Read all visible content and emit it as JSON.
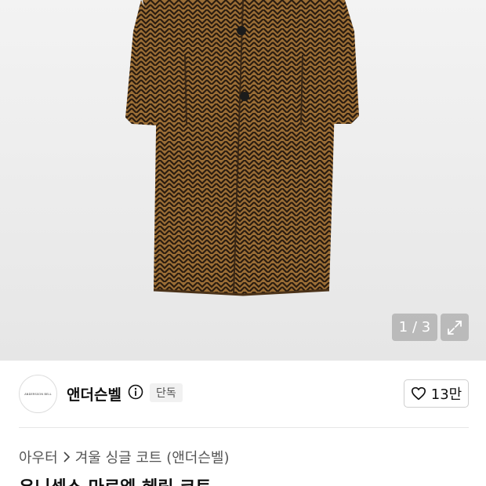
{
  "image_pager": {
    "counter": "1 / 3"
  },
  "brand": {
    "logo_text": "ANDERSSON BELL",
    "name": "앤더슨벨",
    "exclusive_badge": "단독",
    "likes": "13만"
  },
  "breadcrumb": {
    "items": [
      "아우터",
      "겨울 싱글 코트 (앤더슨벨)"
    ]
  },
  "product": {
    "title_partial": "유니섹스 마르엘 헤링 코트 ..."
  },
  "colors": {
    "coat": "#8b6230",
    "pattern_dark": "#2a1c10",
    "button": "#1b1b1b"
  },
  "icons": [
    "info-icon",
    "expand-icon",
    "heart-icon",
    "chevron-right-icon"
  ]
}
